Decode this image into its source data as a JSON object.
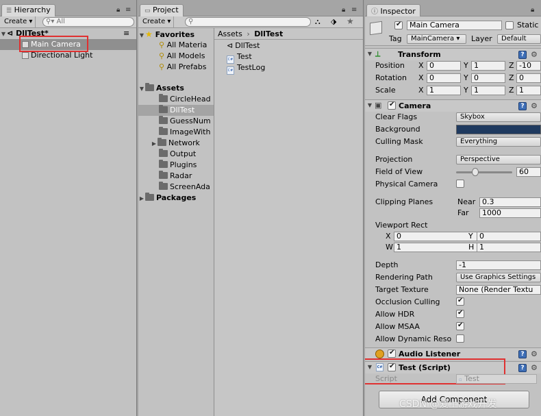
{
  "hierarchy": {
    "tab": "Hierarchy",
    "create": "Create",
    "search": "All",
    "scene": "DllTest*",
    "items": [
      "Main Camera",
      "Directional Light"
    ]
  },
  "project": {
    "tab": "Project",
    "create": "Create",
    "favorites": {
      "label": "Favorites",
      "items": [
        "All Materia",
        "All Models",
        "All Prefabs"
      ]
    },
    "assets": {
      "label": "Assets",
      "items": [
        "CircleHead",
        "DllTest",
        "GuessNum",
        "ImageWith",
        "Network",
        "Output",
        "Plugins",
        "Radar",
        "ScreenAda"
      ]
    },
    "packages": "Packages",
    "breadcrumb": {
      "root": "Assets",
      "sep": "›",
      "current": "DllTest"
    },
    "files": [
      "DllTest",
      "Test",
      "TestLog"
    ]
  },
  "inspector": {
    "tab": "Inspector",
    "object_name": "Main Camera",
    "static_label": "Static",
    "tag_label": "Tag",
    "tag_value": "MainCamera",
    "layer_label": "Layer",
    "layer_value": "Default",
    "transform": {
      "title": "Transform",
      "position_label": "Position",
      "rotation_label": "Rotation",
      "scale_label": "Scale",
      "x": "X",
      "y": "Y",
      "z": "Z",
      "position": [
        "0",
        "1",
        "-10"
      ],
      "rotation": [
        "0",
        "0",
        "0"
      ],
      "scale": [
        "1",
        "1",
        "1"
      ]
    },
    "camera": {
      "title": "Camera",
      "clear_flags_label": "Clear Flags",
      "clear_flags": "Skybox",
      "background_label": "Background",
      "background_color": "#1f3a5f",
      "culling_mask_label": "Culling Mask",
      "culling_mask": "Everything",
      "projection_label": "Projection",
      "projection": "Perspective",
      "fov_label": "Field of View",
      "fov": "60",
      "physical_label": "Physical Camera",
      "clipping_label": "Clipping Planes",
      "near_label": "Near",
      "near": "0.3",
      "far_label": "Far",
      "far": "1000",
      "viewport_label": "Viewport Rect",
      "vx_label": "X",
      "vx": "0",
      "vy_label": "Y",
      "vy": "0",
      "vw_label": "W",
      "vw": "1",
      "vh_label": "H",
      "vh": "1",
      "depth_label": "Depth",
      "depth": "-1",
      "rendering_path_label": "Rendering Path",
      "rendering_path": "Use Graphics Settings",
      "target_texture_label": "Target Texture",
      "target_texture": "None (Render Textu",
      "occlusion_label": "Occlusion Culling",
      "hdr_label": "Allow HDR",
      "msaa_label": "Allow MSAA",
      "dynres_label": "Allow Dynamic Reso"
    },
    "audio_listener": {
      "title": "Audio Listener"
    },
    "script_component": {
      "title": "Test (Script)",
      "script_label": "Script",
      "script_value": "Test"
    },
    "add_component": "Add Component"
  },
  "watermark": "CSDN @爱上游戏开发"
}
